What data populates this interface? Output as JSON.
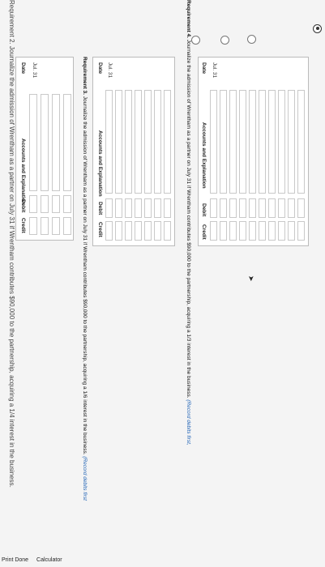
{
  "top_text": "Requirement 2. Journalize the admission of Wrentham as a partner on July 31 if Wrentham contributes $90,000 to the partnership, acquiring a 1/4 interest in the business.",
  "journal1": {
    "headers": {
      "date": "Date",
      "accounts": "Accounts and Explanation",
      "debit": "Debit",
      "credit": "Credit"
    },
    "date": "Jul. 31"
  },
  "req3": {
    "label": "Requirement 3.",
    "text": "Journalize the admission of Wrentham as a partner on July 31 if Wrentham contributes $90,000 to the partnership, acquiring a 1/6 interest in the business.",
    "hint": "(Record debits first"
  },
  "journal2": {
    "headers": {
      "date": "Date",
      "accounts": "Accounts and Explanation",
      "debit": "Debit",
      "credit": "Credit"
    },
    "date": "Jul. 31"
  },
  "req4": {
    "label": "Requirement 4.",
    "text": "Journalize the admission of Wrentham as a partner on July 31 if Wrentham contributes $90,000 to the partnership, acquiring a 1/3 interest in the business.",
    "hint": "(Record debits first,"
  },
  "journal3": {
    "headers": {
      "date": "Date",
      "accounts": "Accounts and Explanation",
      "debit": "Debit",
      "credit": "Credit"
    },
    "date": "Jul. 31"
  },
  "footer": {
    "print_done": "Print Done",
    "calculator": "Calculator"
  }
}
